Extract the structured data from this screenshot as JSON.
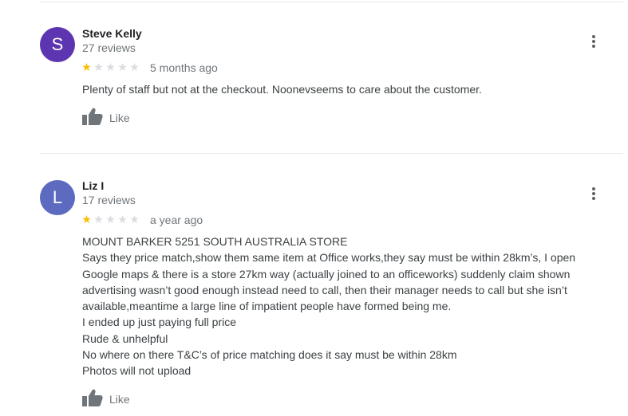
{
  "reviews": [
    {
      "avatar_letter": "S",
      "avatar_color": "#5e35b1",
      "name": "Steve Kelly",
      "review_count": "27 reviews",
      "rating": 1,
      "max_rating": 5,
      "time": "5 months ago",
      "text_lines": [
        "Plenty of staff but not at the checkout. Noonevseems to care about the customer."
      ],
      "like_label": "Like",
      "menu_icon": "more-vert-icon",
      "like_icon": "thumb-up-icon"
    },
    {
      "avatar_letter": "L",
      "avatar_color": "#5c6bc0",
      "name": "Liz I",
      "review_count": "17 reviews",
      "rating": 1,
      "max_rating": 5,
      "time": "a year ago",
      "text_lines": [
        "MOUNT BARKER 5251 SOUTH AUSTRALIA STORE",
        "Says they price match,show them same item at Office works,they say must be within 28km’s, I open",
        "Google maps & there is a store 27km way (actually joined to an officeworks) suddenly claim shown",
        "advertising wasn’t good enough instead need to call, then their manager needs to call but she isn’t",
        "available,meantime a large line of impatient people have formed being me.",
        "I ended up just paying full price",
        "Rude & unhelpful",
        "No where on there T&C’s of price matching does it say must be within 28km",
        "Photos will not upload"
      ],
      "like_label": "Like",
      "menu_icon": "more-vert-icon",
      "like_icon": "thumb-up-icon"
    }
  ],
  "colors": {
    "star_filled": "#fbbc04",
    "star_empty": "#dadce0",
    "divider": "#e8eaed",
    "secondary_text": "#70757a"
  }
}
